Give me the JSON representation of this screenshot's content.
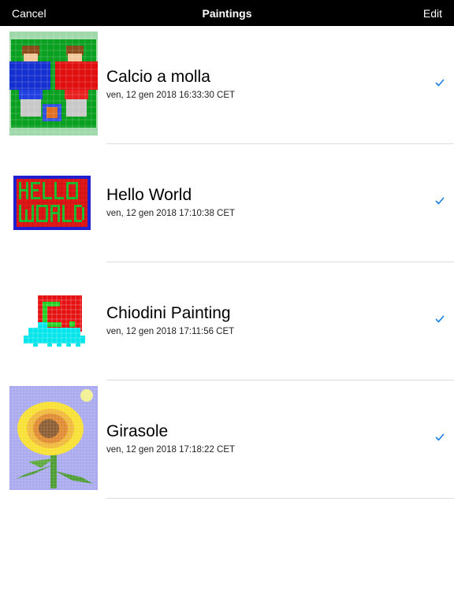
{
  "navbar": {
    "left_label": "Cancel",
    "title": "Paintings",
    "right_label": "Edit"
  },
  "paintings": [
    {
      "title": "Calcio a molla",
      "date": "ven, 12 gen 2018 16:33:30 CET",
      "selected": true,
      "thumbnail": "foosball-players-pixel-art"
    },
    {
      "title": "Hello World",
      "date": "ven, 12 gen 2018 17:10:38 CET",
      "selected": true,
      "thumbnail": "hello-world-pixel-art"
    },
    {
      "title": "Chiodini Painting",
      "date": "ven, 12 gen 2018 17:11:56 CET",
      "selected": true,
      "thumbnail": "red-square-green-c-pixel-art"
    },
    {
      "title": "Girasole",
      "date": "ven, 12 gen 2018 17:18:22 CET",
      "selected": true,
      "thumbnail": "sunflower-pixel-art"
    }
  ],
  "colors": {
    "navbar_bg": "#000000",
    "navbar_text": "#ffffff",
    "accent": "#1a7ee6",
    "separator": "#dcdcdc"
  },
  "icons": {
    "checkmark": "checkmark-icon"
  }
}
